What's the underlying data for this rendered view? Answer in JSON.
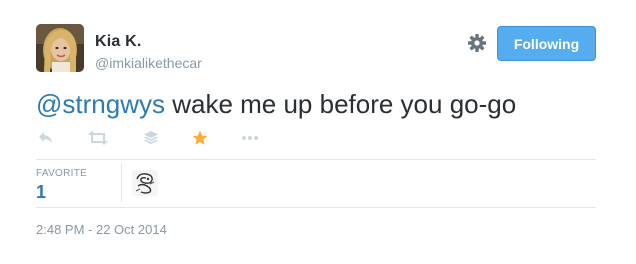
{
  "user": {
    "name": "Kia K.",
    "handle": "@imkialikethecar"
  },
  "follow_button": {
    "label": "Following"
  },
  "tweet": {
    "mention": "@strngwys",
    "body": " wake me up before you go-go"
  },
  "actions": [
    {
      "icon": "reply-icon"
    },
    {
      "icon": "retweet-icon"
    },
    {
      "icon": "buffer-icon"
    },
    {
      "icon": "favorite-star-icon",
      "active": true,
      "color": "#ffac33"
    },
    {
      "icon": "more-icon"
    }
  ],
  "stats": {
    "favorite_label": "FAVORITE",
    "favorite_count": "1"
  },
  "timestamp": "2:48 PM - 22 Oct 2014",
  "colors": {
    "link": "#2b7bb9",
    "button": "#55acee",
    "muted": "#8899a6",
    "star": "#ffac33",
    "icon": "#ccd6dd"
  }
}
